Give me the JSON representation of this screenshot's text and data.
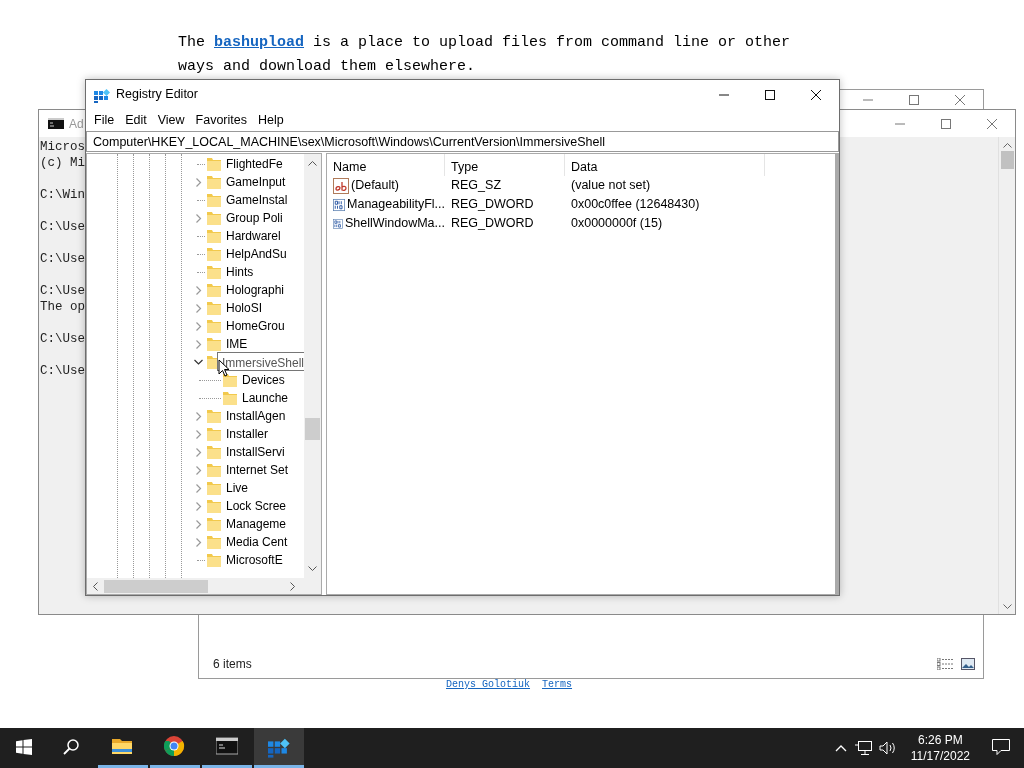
{
  "web_page": {
    "intro": {
      "before": "The ",
      "link": "bashupload",
      "after": " is a place to upload files from command line or other ways and download them elsewhere."
    },
    "footer_links": [
      "Denys Golotiuk",
      "Terms"
    ]
  },
  "explorer_window": {
    "status": "6 items"
  },
  "cmd_window": {
    "title": "Ad",
    "paragraphs": [
      [
        "Micros",
        "(c) Mi"
      ],
      [
        "C:\\Win"
      ],
      [
        "C:\\Use"
      ],
      [
        "C:\\Use"
      ],
      [
        "C:\\Use",
        "The op"
      ],
      [
        "C:\\Use"
      ],
      [
        "C:\\Use"
      ]
    ]
  },
  "registry_editor": {
    "title": "Registry Editor",
    "menu": [
      "File",
      "Edit",
      "View",
      "Favorites",
      "Help"
    ],
    "address": "Computer\\HKEY_LOCAL_MACHINE\\sex\\Microsoft\\Windows\\CurrentVersion\\ImmersiveShell",
    "tree": [
      {
        "label": "FlightedFe",
        "kind": "leaf"
      },
      {
        "label": "GameInput",
        "kind": "collapsed"
      },
      {
        "label": "GameInstal",
        "kind": "leaf"
      },
      {
        "label": "Group Poli",
        "kind": "collapsed"
      },
      {
        "label": "Hardwarel",
        "kind": "leaf"
      },
      {
        "label": "HelpAndSu",
        "kind": "leaf"
      },
      {
        "label": "Hints",
        "kind": "leaf"
      },
      {
        "label": "Holographi",
        "kind": "collapsed"
      },
      {
        "label": "HoloSI",
        "kind": "collapsed"
      },
      {
        "label": "HomeGrou",
        "kind": "collapsed"
      },
      {
        "label": "IME",
        "kind": "collapsed"
      },
      {
        "label": "ImmersiveShell",
        "kind": "expanded",
        "children": [
          {
            "label": "Devices",
            "kind": "leaf"
          },
          {
            "label": "Launche",
            "kind": "leaf"
          }
        ]
      },
      {
        "label": "InstallAgen",
        "kind": "collapsed"
      },
      {
        "label": "Installer",
        "kind": "collapsed"
      },
      {
        "label": "InstallServi",
        "kind": "collapsed"
      },
      {
        "label": "Internet Set",
        "kind": "collapsed"
      },
      {
        "label": "Live",
        "kind": "collapsed"
      },
      {
        "label": "Lock Scree",
        "kind": "collapsed"
      },
      {
        "label": "Manageme",
        "kind": "collapsed"
      },
      {
        "label": "Media Cent",
        "kind": "collapsed"
      },
      {
        "label": "MicrosoftE",
        "kind": "leaf"
      }
    ],
    "columns": [
      "Name",
      "Type",
      "Data"
    ],
    "values": [
      {
        "kind": "string",
        "name": "(Default)",
        "type": "REG_SZ",
        "data": "(value not set)"
      },
      {
        "kind": "binary",
        "name": "ManageabilityFl...",
        "type": "REG_DWORD",
        "data": "0x00c0ffee (12648430)"
      },
      {
        "kind": "binary",
        "name": "ShellWindowMa...",
        "type": "REG_DWORD",
        "data": "0x0000000f (15)"
      }
    ]
  },
  "taskbar": {
    "apps": [
      {
        "kind": "explorer",
        "selected": false
      },
      {
        "kind": "chrome",
        "selected": false
      },
      {
        "kind": "cmd",
        "selected": false
      },
      {
        "kind": "regedit",
        "selected": true
      }
    ],
    "time": "6:26 PM",
    "date": "11/17/2022"
  }
}
